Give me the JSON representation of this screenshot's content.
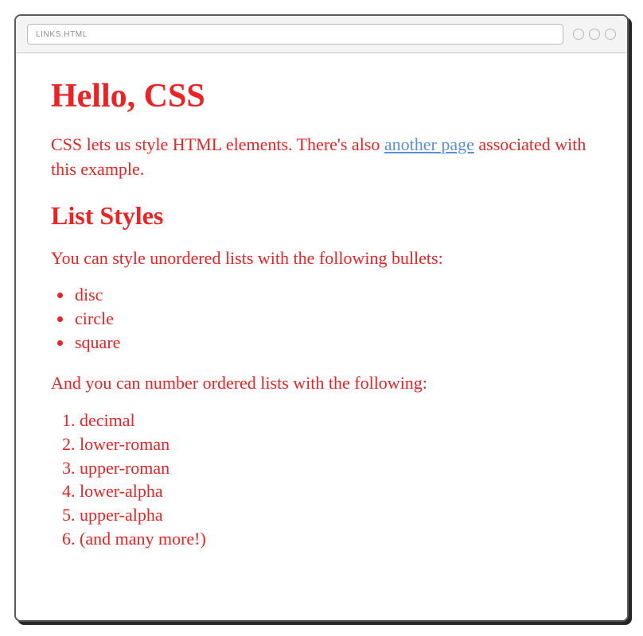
{
  "browser": {
    "url": "LINKS.HTML"
  },
  "page": {
    "heading1": "Hello, CSS",
    "intro_pre": "CSS lets us style HTML elements. There's also ",
    "intro_link": "another page",
    "intro_post": " associated with this example.",
    "heading2": "List Styles",
    "ul_intro": "You can style unordered lists with the following bullets:",
    "ul_items": {
      "0": "disc",
      "1": "circle",
      "2": "square"
    },
    "ol_intro": "And you can number ordered lists with the following:",
    "ol_items": {
      "0": "decimal",
      "1": "lower-roman",
      "2": "upper-roman",
      "3": "lower-alpha",
      "4": "upper-alpha",
      "5": "(and many more!)"
    }
  }
}
